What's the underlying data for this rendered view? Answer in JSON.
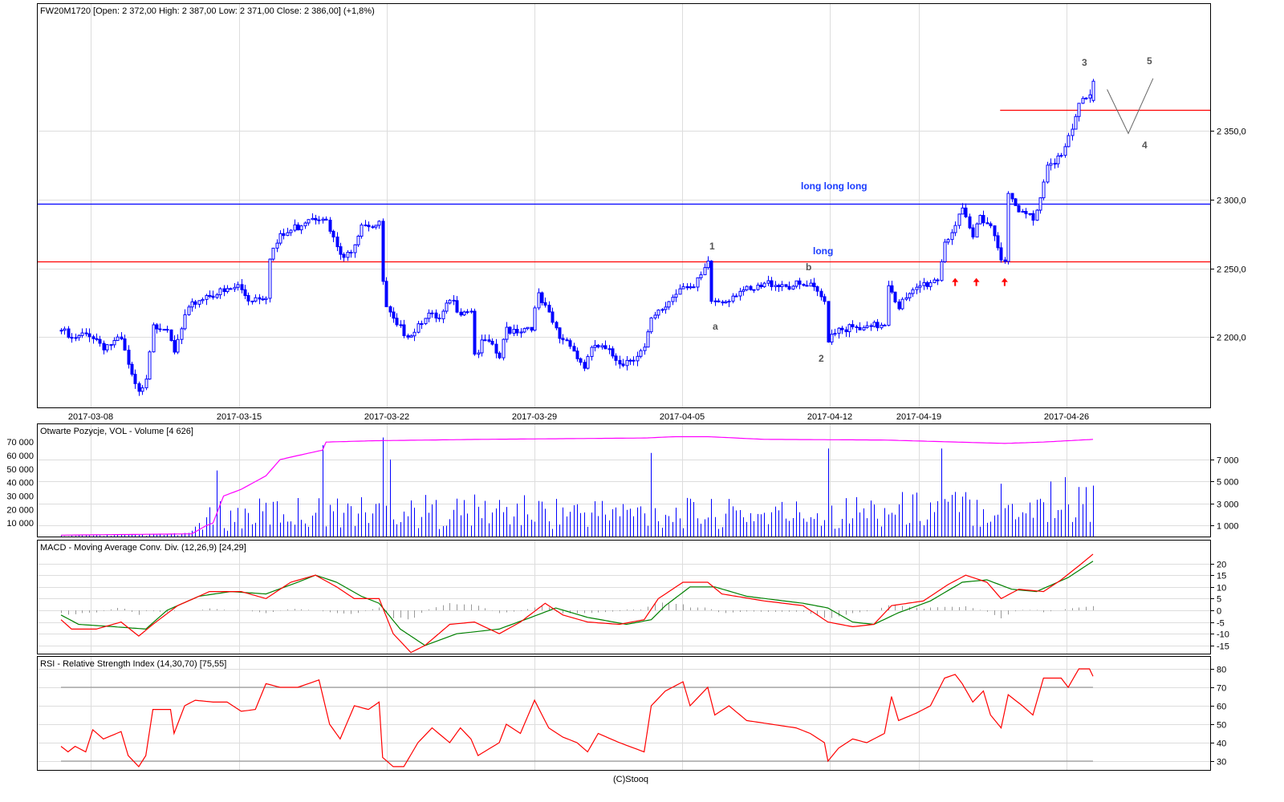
{
  "header": {
    "title": "FW20M1720 [Open: 2 372,00  High: 2 387,00  Low: 2 371,00  Close: 2 386,00] (+1,8%)"
  },
  "footer": {
    "copyright": "(C)Stooq"
  },
  "colors": {
    "candle": "#0000ff",
    "support": "#ff0000",
    "resistance": "#0000ff",
    "oi": "#ff00ff",
    "macd": "#ff0000",
    "signal": "#008000",
    "hist": "#999999",
    "rsi": "#ff0000"
  },
  "chart_data": [
    {
      "type": "candlestick",
      "title": "FW20M1720 [Open: 2 372,00  High: 2 387,00  Low: 2 371,00  Close: 2 386,00] (+1,8%)",
      "x_ticks": [
        "2017-03-08",
        "2017-03-15",
        "2017-03-22",
        "2017-03-29",
        "2017-04-05",
        "2017-04-12",
        "2017-04-19",
        "2017-04-26"
      ],
      "y_ticks": [
        "2 350,0",
        "2 300,0",
        "2 250,0",
        "2 200,0"
      ],
      "y_tick_values": [
        2350,
        2300,
        2250,
        2200
      ],
      "ylim": [
        2148,
        2442
      ],
      "bars": 292,
      "close_keypoints": [
        [
          0,
          2205
        ],
        [
          3,
          2197
        ],
        [
          8,
          2203
        ],
        [
          12,
          2194
        ],
        [
          17,
          2197
        ],
        [
          20,
          2170
        ],
        [
          22,
          2158
        ],
        [
          24,
          2173
        ],
        [
          26,
          2211
        ],
        [
          29,
          2208
        ],
        [
          32,
          2188
        ],
        [
          35,
          2214
        ],
        [
          38,
          2226
        ],
        [
          42,
          2232
        ],
        [
          46,
          2232
        ],
        [
          50,
          2237
        ],
        [
          53,
          2228
        ],
        [
          58,
          2231
        ],
        [
          59,
          2260
        ],
        [
          62,
          2272
        ],
        [
          67,
          2281
        ],
        [
          70,
          2288
        ],
        [
          74,
          2289
        ],
        [
          77,
          2270
        ],
        [
          80,
          2255
        ],
        [
          83,
          2270
        ],
        [
          85,
          2284
        ],
        [
          90,
          2281
        ],
        [
          91,
          2240
        ],
        [
          92,
          2220
        ],
        [
          95,
          2206
        ],
        [
          99,
          2203
        ],
        [
          103,
          2217
        ],
        [
          107,
          2211
        ],
        [
          110,
          2226
        ],
        [
          113,
          2220
        ],
        [
          116,
          2221
        ],
        [
          117,
          2188
        ],
        [
          120,
          2197
        ],
        [
          124,
          2185
        ],
        [
          126,
          2206
        ],
        [
          130,
          2206
        ],
        [
          133,
          2209
        ],
        [
          135,
          2229
        ],
        [
          137,
          2220
        ],
        [
          141,
          2200
        ],
        [
          144,
          2197
        ],
        [
          146,
          2185
        ],
        [
          148,
          2179
        ],
        [
          151,
          2194
        ],
        [
          155,
          2188
        ],
        [
          159,
          2182
        ],
        [
          165,
          2191
        ],
        [
          167,
          2211
        ],
        [
          171,
          2223
        ],
        [
          176,
          2240
        ],
        [
          179,
          2235
        ],
        [
          183,
          2252
        ],
        [
          184,
          2226
        ],
        [
          187,
          2226
        ],
        [
          192,
          2235
        ],
        [
          195,
          2232
        ],
        [
          201,
          2240
        ],
        [
          208,
          2237
        ],
        [
          212,
          2236
        ],
        [
          216,
          2226
        ],
        [
          217,
          2200
        ],
        [
          220,
          2208
        ],
        [
          225,
          2205
        ],
        [
          228,
          2205
        ],
        [
          233,
          2211
        ],
        [
          234,
          2240
        ],
        [
          237,
          2223
        ],
        [
          240,
          2229
        ],
        [
          243,
          2237
        ],
        [
          248,
          2243
        ],
        [
          250,
          2270
        ],
        [
          253,
          2281
        ],
        [
          255,
          2290
        ],
        [
          258,
          2272
        ],
        [
          260,
          2290
        ],
        [
          263,
          2281
        ],
        [
          266,
          2260
        ],
        [
          267,
          2258
        ],
        [
          268,
          2302
        ],
        [
          271,
          2290
        ],
        [
          275,
          2287
        ],
        [
          277,
          2302
        ],
        [
          279,
          2328
        ],
        [
          283,
          2331
        ],
        [
          286,
          2349
        ],
        [
          288,
          2369
        ],
        [
          291,
          2378
        ],
        [
          292,
          2386
        ]
      ],
      "horizontal_lines": [
        {
          "price": 2297,
          "color": "blue"
        },
        {
          "price": 2255,
          "color": "red"
        },
        {
          "price": 2365,
          "color": "red",
          "from_bar": 268
        }
      ],
      "annotations": {
        "long_long_long": "long long long",
        "long": "long",
        "wave_1": "1",
        "wave_a": "a",
        "wave_b": "b",
        "wave_2": "2",
        "wave_3": "3",
        "wave_4": "4",
        "wave_5": "5"
      },
      "projection": [
        [
          296,
          2380
        ],
        [
          302,
          2348
        ],
        [
          309,
          2388
        ]
      ],
      "buy_arrows_bars": [
        253,
        259,
        267
      ]
    },
    {
      "type": "bar+line",
      "title": "Otwarte Pozycje, VOL - Volume [4 626]",
      "left_ticks": [
        "70 000",
        "60 000",
        "50 000",
        "40 000",
        "30 000",
        "20 000",
        "10 000"
      ],
      "left_tick_values": [
        70000,
        60000,
        50000,
        40000,
        30000,
        20000,
        10000
      ],
      "right_ticks": [
        "7 000",
        "5 000",
        "3 000",
        "1 000"
      ],
      "right_tick_values": [
        7000,
        5000,
        3000,
        1000
      ],
      "open_interest_keypoints": [
        [
          0,
          1000
        ],
        [
          37,
          2000
        ],
        [
          41,
          8000
        ],
        [
          43,
          10000
        ],
        [
          46,
          30000
        ],
        [
          51,
          35000
        ],
        [
          58,
          45000
        ],
        [
          62,
          57000
        ],
        [
          67,
          60000
        ],
        [
          74,
          64000
        ],
        [
          75,
          70000
        ],
        [
          89,
          71000
        ],
        [
          119,
          72000
        ],
        [
          165,
          73000
        ],
        [
          174,
          74000
        ],
        [
          183,
          74000
        ],
        [
          199,
          72000
        ],
        [
          233,
          71500
        ],
        [
          267,
          69000
        ],
        [
          278,
          70000
        ],
        [
          292,
          72000
        ]
      ],
      "volume_base_keypoints": [
        [
          0,
          50
        ],
        [
          36,
          200
        ],
        [
          40,
          1500
        ],
        [
          60,
          2200
        ],
        [
          120,
          2300
        ],
        [
          200,
          2000
        ],
        [
          240,
          2500
        ],
        [
          292,
          3000
        ]
      ],
      "volume_spikes": [
        [
          44,
          6000
        ],
        [
          45,
          3200
        ],
        [
          74,
          8300
        ],
        [
          91,
          9000
        ],
        [
          93,
          7000
        ],
        [
          167,
          7600
        ],
        [
          217,
          8000
        ],
        [
          249,
          8000
        ],
        [
          266,
          4800
        ],
        [
          280,
          5000
        ],
        [
          284,
          5400
        ],
        [
          292,
          4626
        ]
      ]
    },
    {
      "type": "line",
      "title": "MACD - Moving Average Conv. Div. (12,26,9) [24,29]",
      "y_ticks": [
        "20",
        "15",
        "10",
        "5",
        "0",
        "-5",
        "-10",
        "-15"
      ],
      "y_tick_values": [
        20,
        15,
        10,
        5,
        0,
        -5,
        -10,
        -15
      ],
      "macd_keypoints": [
        [
          0,
          -4
        ],
        [
          3,
          -8
        ],
        [
          10,
          -8
        ],
        [
          17,
          -5
        ],
        [
          22,
          -11
        ],
        [
          26,
          -6
        ],
        [
          33,
          2
        ],
        [
          42,
          8
        ],
        [
          51,
          8
        ],
        [
          58,
          5
        ],
        [
          65,
          12
        ],
        [
          72,
          15
        ],
        [
          78,
          10
        ],
        [
          83,
          5
        ],
        [
          90,
          5
        ],
        [
          94,
          -10
        ],
        [
          99,
          -18
        ],
        [
          103,
          -15
        ],
        [
          110,
          -6
        ],
        [
          117,
          -5
        ],
        [
          124,
          -10
        ],
        [
          130,
          -5
        ],
        [
          137,
          3
        ],
        [
          142,
          -2
        ],
        [
          149,
          -5
        ],
        [
          158,
          -6
        ],
        [
          165,
          -4
        ],
        [
          169,
          5
        ],
        [
          176,
          12
        ],
        [
          183,
          12
        ],
        [
          187,
          7
        ],
        [
          199,
          4
        ],
        [
          210,
          2
        ],
        [
          217,
          -5
        ],
        [
          224,
          -7
        ],
        [
          230,
          -6
        ],
        [
          235,
          2
        ],
        [
          244,
          4
        ],
        [
          251,
          11
        ],
        [
          256,
          15
        ],
        [
          262,
          12
        ],
        [
          266,
          5
        ],
        [
          271,
          9
        ],
        [
          278,
          8
        ],
        [
          283,
          13
        ],
        [
          288,
          19
        ],
        [
          292,
          24
        ]
      ],
      "signal_keypoints": [
        [
          0,
          -2
        ],
        [
          5,
          -6
        ],
        [
          15,
          -7
        ],
        [
          24,
          -8
        ],
        [
          30,
          0
        ],
        [
          39,
          6
        ],
        [
          48,
          8
        ],
        [
          58,
          7
        ],
        [
          67,
          12
        ],
        [
          72,
          15
        ],
        [
          78,
          12
        ],
        [
          85,
          6
        ],
        [
          90,
          3
        ],
        [
          96,
          -8
        ],
        [
          103,
          -15
        ],
        [
          112,
          -10
        ],
        [
          124,
          -8
        ],
        [
          133,
          -3
        ],
        [
          140,
          1
        ],
        [
          149,
          -3
        ],
        [
          160,
          -6
        ],
        [
          167,
          -4
        ],
        [
          171,
          2
        ],
        [
          178,
          10
        ],
        [
          185,
          10
        ],
        [
          194,
          6
        ],
        [
          210,
          3
        ],
        [
          217,
          1
        ],
        [
          224,
          -5
        ],
        [
          230,
          -6
        ],
        [
          237,
          -1
        ],
        [
          246,
          4
        ],
        [
          255,
          12
        ],
        [
          262,
          13
        ],
        [
          269,
          9
        ],
        [
          276,
          8
        ],
        [
          285,
          14
        ],
        [
          292,
          21
        ]
      ]
    },
    {
      "type": "line",
      "title": "RSI - Relative Strength Index (14,30,70) [75,55]",
      "y_ticks": [
        "80",
        "70",
        "60",
        "50",
        "40",
        "30"
      ],
      "y_tick_values": [
        80,
        70,
        60,
        50,
        40,
        30
      ],
      "levels": [
        70,
        30
      ],
      "rsi_keypoints": [
        [
          0,
          38
        ],
        [
          2,
          35
        ],
        [
          4,
          38
        ],
        [
          7,
          35
        ],
        [
          9,
          47
        ],
        [
          12,
          42
        ],
        [
          17,
          46
        ],
        [
          19,
          33
        ],
        [
          22,
          27
        ],
        [
          24,
          33
        ],
        [
          26,
          58
        ],
        [
          31,
          58
        ],
        [
          32,
          45
        ],
        [
          35,
          60
        ],
        [
          38,
          63
        ],
        [
          43,
          62
        ],
        [
          47,
          62
        ],
        [
          51,
          57
        ],
        [
          55,
          58
        ],
        [
          58,
          72
        ],
        [
          62,
          70
        ],
        [
          67,
          70
        ],
        [
          73,
          74
        ],
        [
          76,
          50
        ],
        [
          79,
          42
        ],
        [
          83,
          60
        ],
        [
          87,
          58
        ],
        [
          90,
          62
        ],
        [
          91,
          32
        ],
        [
          94,
          27
        ],
        [
          97,
          27
        ],
        [
          101,
          40
        ],
        [
          105,
          48
        ],
        [
          110,
          40
        ],
        [
          113,
          48
        ],
        [
          116,
          42
        ],
        [
          118,
          33
        ],
        [
          124,
          40
        ],
        [
          126,
          50
        ],
        [
          130,
          45
        ],
        [
          134,
          63
        ],
        [
          138,
          48
        ],
        [
          142,
          43
        ],
        [
          146,
          40
        ],
        [
          149,
          35
        ],
        [
          152,
          45
        ],
        [
          158,
          40
        ],
        [
          165,
          35
        ],
        [
          167,
          60
        ],
        [
          171,
          68
        ],
        [
          176,
          73
        ],
        [
          178,
          60
        ],
        [
          183,
          70
        ],
        [
          185,
          55
        ],
        [
          189,
          60
        ],
        [
          194,
          52
        ],
        [
          201,
          50
        ],
        [
          208,
          48
        ],
        [
          212,
          45
        ],
        [
          216,
          40
        ],
        [
          217,
          30
        ],
        [
          220,
          37
        ],
        [
          224,
          42
        ],
        [
          228,
          40
        ],
        [
          233,
          45
        ],
        [
          235,
          65
        ],
        [
          237,
          52
        ],
        [
          242,
          56
        ],
        [
          246,
          60
        ],
        [
          250,
          75
        ],
        [
          253,
          77
        ],
        [
          255,
          72
        ],
        [
          258,
          62
        ],
        [
          261,
          68
        ],
        [
          263,
          55
        ],
        [
          266,
          48
        ],
        [
          268,
          66
        ],
        [
          272,
          60
        ],
        [
          275,
          55
        ],
        [
          278,
          75
        ],
        [
          283,
          75
        ],
        [
          285,
          70
        ],
        [
          288,
          80
        ],
        [
          291,
          80
        ],
        [
          292,
          76
        ]
      ]
    }
  ]
}
